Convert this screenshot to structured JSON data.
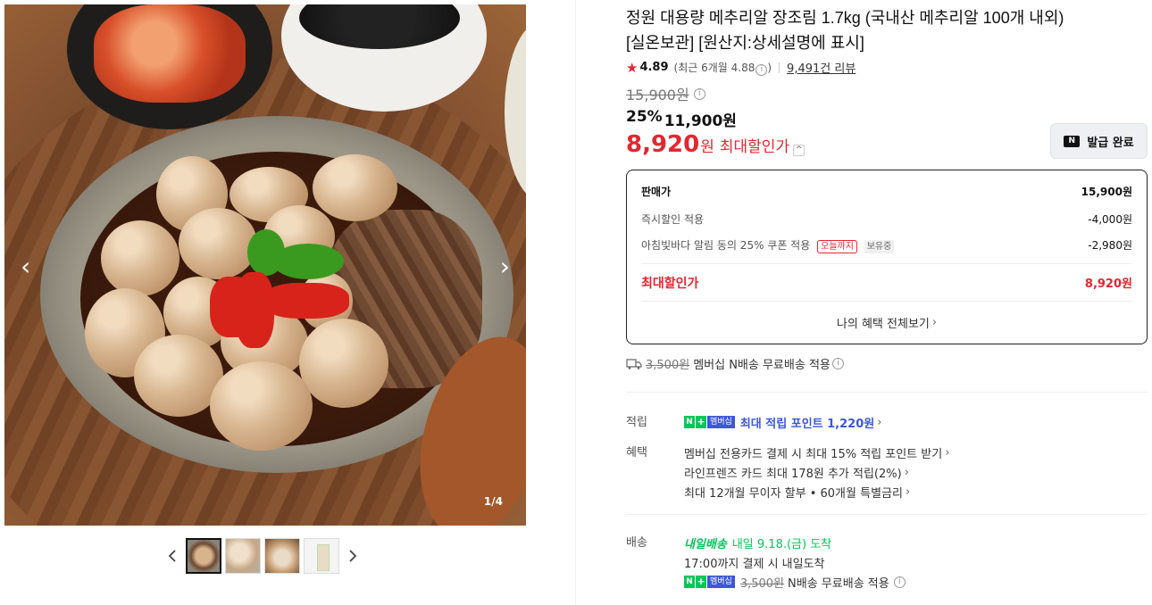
{
  "gallery": {
    "counter": "1/4",
    "prev_icon": "chevron-left-icon",
    "next_icon": "chevron-right-icon"
  },
  "product": {
    "title_line1": "정원 대용량 메추리알 장조림 1.7kg (국내산 메추리알 100개 내외)",
    "title_line2": "[실온보관] [원산지:상세설명에 표시]",
    "rating": "4.89",
    "recent_rating_prefix": "(최근 6개월 4.88",
    "recent_rating_suffix": ")",
    "review_count": "9,491건 리뷰",
    "original_price": "15,900원",
    "discount_rate": "25%",
    "sale_price": "11,900원",
    "max_price_number": "8,920",
    "max_price_unit": "원",
    "max_price_label": "최대할인가"
  },
  "coupon_button": {
    "label": "발급 완료",
    "logo": "N"
  },
  "breakdown": {
    "rows": [
      {
        "label": "판매가",
        "amount": "15,900원"
      },
      {
        "label": "즉시할인 적용",
        "amount": "-4,000원"
      },
      {
        "label": "아침빛바다 알림 동의 25% 쿠폰 적용",
        "amount": "-2,980원",
        "tag_today": "오늘까지",
        "tag_own": "보유중"
      }
    ],
    "total_label": "최대할인가",
    "total_amount": "8,920원",
    "more_label": "나의 혜택 전체보기"
  },
  "shipping_summary": {
    "original_fee": "3,500원",
    "text": "멤버십 N배송 무료배송 적용"
  },
  "points": {
    "key": "적립",
    "badge_member": "멤버십",
    "text": "최대 적립 포인트 1,220원"
  },
  "benefits": {
    "key": "혜택",
    "items": [
      "멤버십 전용카드 결제 시 최대 15% 적립 포인트 받기",
      "라인프렌즈 카드 최대 178원 추가 적립(2%)",
      "최대 12개월 무이자 할부 • 60개월 특별금리"
    ]
  },
  "delivery": {
    "key": "배송",
    "badge": "내일배송",
    "arrival": "내일 9.18.(금) 도착",
    "deadline": "17:00까지 결제 시 내일도착",
    "badge_member": "멤버십",
    "original_fee": "3,500원",
    "text": "N배송 무료배송 적용"
  }
}
